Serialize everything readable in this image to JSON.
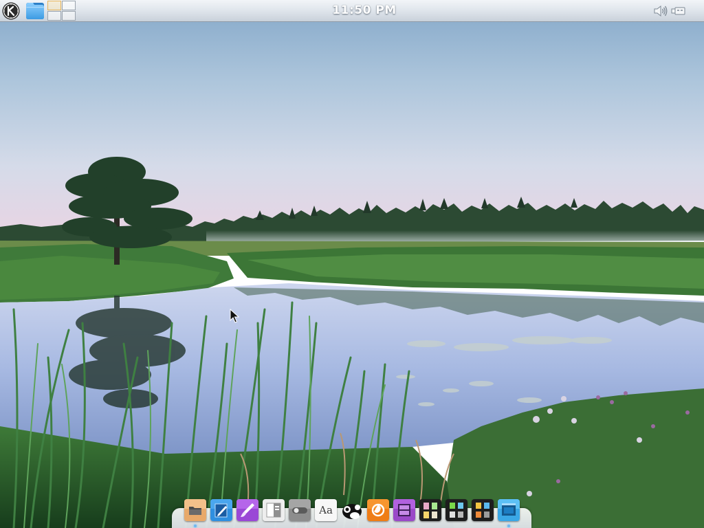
{
  "top_panel": {
    "clock": "11:50 PM",
    "launcher_icon": "kde-logo-icon",
    "folder_icon": "folder-icon",
    "pager": {
      "desktops": 4,
      "active_desktop": 1
    },
    "tray": [
      "volume-icon",
      "usb-icon"
    ]
  },
  "wallpaper": {
    "description_icon": "landscape-wallpaper",
    "sky_top": "#8fb2d1",
    "horizon": "#e7d3e2",
    "water": "#a9bde3"
  },
  "dock": {
    "items": [
      {
        "icon": "file-manager-icon",
        "running": true
      },
      {
        "icon": "text-editor-icon",
        "running": false
      },
      {
        "icon": "paint-brush-icon",
        "running": false
      },
      {
        "icon": "document-viewer-icon",
        "running": false
      },
      {
        "icon": "toggle-settings-icon",
        "running": false
      },
      {
        "icon": "font-viewer-icon",
        "label": "Aa",
        "running": false
      },
      {
        "icon": "archive-mascot-icon",
        "running": false
      },
      {
        "icon": "firefox-icon",
        "running": false
      },
      {
        "icon": "media-player-icon",
        "running": false
      },
      {
        "icon": "office-apps-grid-icon",
        "running": false
      },
      {
        "icon": "system-grid-icon",
        "running": false
      },
      {
        "icon": "tools-grid-icon",
        "running": false
      },
      {
        "icon": "window-switcher-icon",
        "running": true
      }
    ]
  },
  "colors": {
    "panel": "#dde3ea",
    "accent_blue": "#4aa6e8",
    "running_dot": "#6fb8f0"
  }
}
